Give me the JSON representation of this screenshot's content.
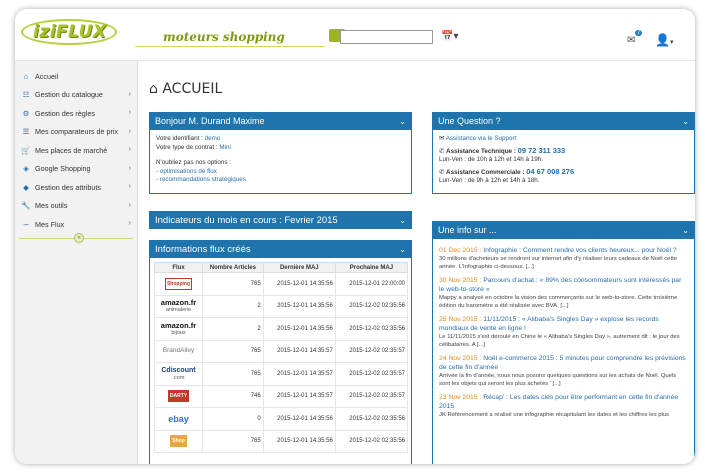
{
  "header": {
    "logo_text": "iziFLUX",
    "slogan": "moteurs shopping",
    "search_value": "",
    "mail_badge": "7"
  },
  "sidebar": {
    "items": [
      {
        "label": "Accueil",
        "icon": "home-icon",
        "chevron": false
      },
      {
        "label": "Gestion du catalogue",
        "icon": "sitemap-icon",
        "chevron": true
      },
      {
        "label": "Gestion des règles",
        "icon": "gear-icon",
        "chevron": true
      },
      {
        "label": "Mes comparateurs de prix",
        "icon": "list-icon",
        "chevron": true
      },
      {
        "label": "Mes places de marché",
        "icon": "cart-icon",
        "chevron": true
      },
      {
        "label": "Google Shopping",
        "icon": "tag-icon",
        "chevron": true
      },
      {
        "label": "Gestion des attributs",
        "icon": "tags-icon",
        "chevron": true
      },
      {
        "label": "Mes outils",
        "icon": "wrench-icon",
        "chevron": true
      },
      {
        "label": "Mes Flux",
        "icon": "rss-icon",
        "chevron": true
      }
    ]
  },
  "main": {
    "title": "ACCUEIL",
    "welcome": {
      "head": "Bonjour M. Durand Maxime",
      "id_label": "Votre identifiant : ",
      "id_value": "demo",
      "contract_label": "Votre type de contrat : ",
      "contract_value": "Mini",
      "options_label": "N'oubliez pas nos options :",
      "option1": "- optimisations de flux",
      "option2": "- recommandations stratégiques"
    },
    "question": {
      "head": "Une Question ?",
      "support": "Assistance via le Support",
      "tech_label": "Assistance Technique : ",
      "tech_phone": "09 72 311 333",
      "tech_hours": "Lun-Ven : de 10h à 12h et 14h à 19h.",
      "com_label": "Assistance Commerciale : ",
      "com_phone": "04 67 008 276",
      "com_hours": "Lun-Ven : de 9h à 12h et 14h à 18h."
    },
    "indicators_head": "Indicateurs du mois en cours : Fevrier 2015",
    "flux_head": "Informations flux créés",
    "info_head": "Une info sur ...",
    "table": {
      "columns": [
        "Flux",
        "Nombre Articles",
        "Dernière MAJ",
        "Prochaine MAJ"
      ],
      "rows": [
        {
          "logo": "Shopping",
          "sub": "",
          "count": "765",
          "last": "2015-12-01 14:35:56",
          "next": "2015-12-01 22:00:00"
        },
        {
          "logo": "amazon.fr",
          "sub": "animalerie",
          "count": "2",
          "last": "2015-12-01 14:35:56",
          "next": "2015-12-02 02:35:56"
        },
        {
          "logo": "amazon.fr",
          "sub": "bijoux",
          "count": "2",
          "last": "2015-12-01 14:35:56",
          "next": "2015-12-02 02:35:56"
        },
        {
          "logo": "BrandAlley",
          "sub": "",
          "count": "765",
          "last": "2015-12-01 14:35:57",
          "next": "2015-12-02 02:35:57"
        },
        {
          "logo": "Cdiscount",
          "sub": ".com",
          "count": "765",
          "last": "2015-12-01 14:35:57",
          "next": "2015-12-02 02:35:57"
        },
        {
          "logo": "DARTY",
          "sub": "",
          "count": "746",
          "last": "2015-12-01 14:35:57",
          "next": "2015-12-02 02:35:57"
        },
        {
          "logo": "ebay",
          "sub": "",
          "count": "0",
          "last": "2015-12-01 14:35:56",
          "next": "2015-12-02 02:35:56"
        },
        {
          "logo": "Shop",
          "sub": "",
          "count": "765",
          "last": "2015-12-01 14:35:56",
          "next": "2015-12-02 02:35:56"
        }
      ]
    },
    "news": [
      {
        "date": "01 Dec 2015",
        "title": "Infographie : Comment rendre vos clients heureux... pour Noël ?",
        "text": "30 millions d'acheteurs se rendront sur internet afin d'y réaliser leurs cadeaux de Noël cette année. L'Infographie ci-dessous. [...]"
      },
      {
        "date": "30 Nov 2015",
        "title": "Parcours d'achat : « 89% des consommateurs sont intéressés par le web-to-store »",
        "text": "Mappy a analysé en octobre la vision des commerçants sur le web-to-store. Cette troisième édition du baromètre a été réalisée avec BVA. [...]"
      },
      {
        "date": "25 Nov 2015",
        "title": "11/11/2015 : « Alibaba's Singles Day » explose les records mondiaux de vente en ligne !",
        "text": "Le 11/11/2015 s'est déroulé en Chine le « Alibaba's Singles Day », autrement dit : le jour des célibataires. A [...]"
      },
      {
        "date": "24 Nov 2015",
        "title": "Noël e-commerce 2015 : 5 minutes pour comprendre les prévisions de cette fin d'année",
        "text": "Arrivée la fin d'année, nous nous posons quelques questions sur les achats de Noël. Quels sont les objets qui seront les plus achetés ' [...]"
      },
      {
        "date": "23 Nov 2015",
        "title": "Récap' : Les dates clés pour être performant en cette fin d'année 2015",
        "text": "JK Référencement a réalisé une infographie récapitulant les dates et les chiffres les plus"
      }
    ]
  }
}
